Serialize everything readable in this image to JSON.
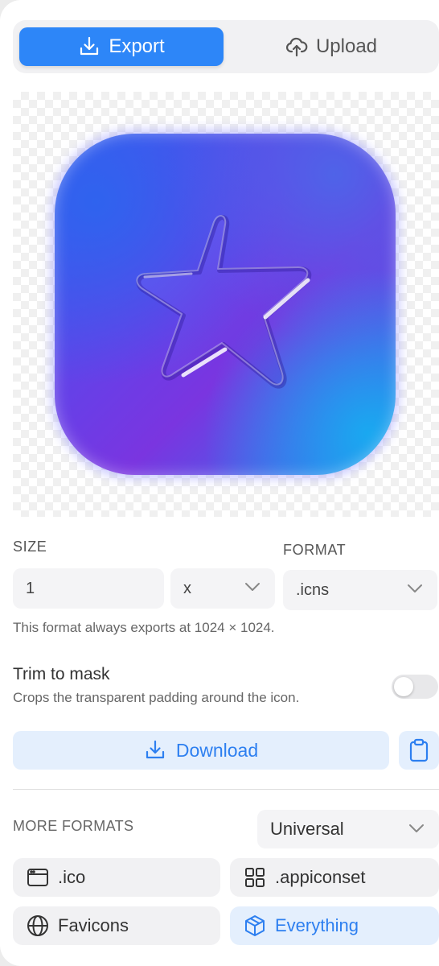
{
  "tabs": [
    {
      "label": "Export",
      "icon": "download-tray-icon",
      "active": true
    },
    {
      "label": "Upload",
      "icon": "cloud-upload-icon",
      "active": false
    }
  ],
  "preview": {
    "icon": "star-app-icon"
  },
  "size": {
    "label": "SIZE",
    "value": "1",
    "multiplier": "x"
  },
  "format": {
    "label": "FORMAT",
    "value": ".icns"
  },
  "note": "This format always exports at 1024 × 1024.",
  "trim": {
    "title": "Trim to mask",
    "subtitle": "Crops the transparent padding around the icon.",
    "enabled": false
  },
  "download_label": "Download",
  "more": {
    "label": "MORE FORMATS",
    "platform": "Universal",
    "items": [
      {
        "label": ".ico",
        "icon": "window-icon"
      },
      {
        "label": ".appiconset",
        "icon": "grid-icon"
      },
      {
        "label": "Favicons",
        "icon": "globe-icon"
      },
      {
        "label": "Everything",
        "icon": "cube-icon"
      }
    ]
  },
  "colors": {
    "accent": "#2d86f8",
    "accent_soft": "#e4effd"
  }
}
